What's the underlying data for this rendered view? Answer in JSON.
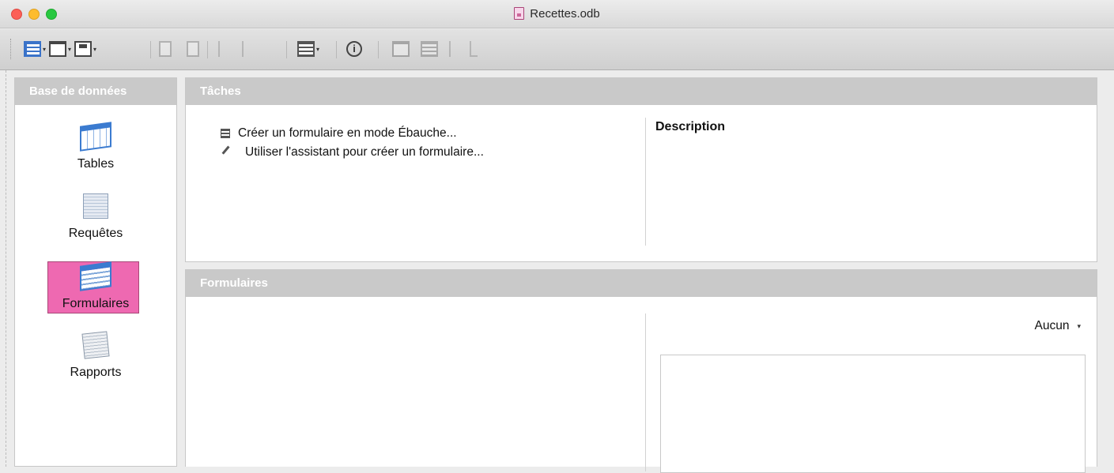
{
  "window": {
    "title": "Recettes.odb"
  },
  "sidebar": {
    "header": "Base de données",
    "items": [
      {
        "label": "Tables",
        "icon": "tables-icon",
        "selected": false
      },
      {
        "label": "Requêtes",
        "icon": "queries-icon",
        "selected": false
      },
      {
        "label": "Formulaires",
        "icon": "forms-icon",
        "selected": true
      },
      {
        "label": "Rapports",
        "icon": "reports-icon",
        "selected": false
      }
    ]
  },
  "tasks": {
    "header": "Tâches",
    "items": [
      {
        "label": "Créer un formulaire en mode Ébauche...",
        "icon": "form-design-icon"
      },
      {
        "label": "Utiliser l'assistant pour créer un formulaire...",
        "icon": "wizard-wand-icon"
      }
    ],
    "description_label": "Description"
  },
  "forms": {
    "header": "Formulaires",
    "preview_mode": "Aucun"
  },
  "colors": {
    "selected_highlight": "#ee69b1",
    "panel_header": "#c9c9c9",
    "accent_blue": "#3b7bd0"
  }
}
